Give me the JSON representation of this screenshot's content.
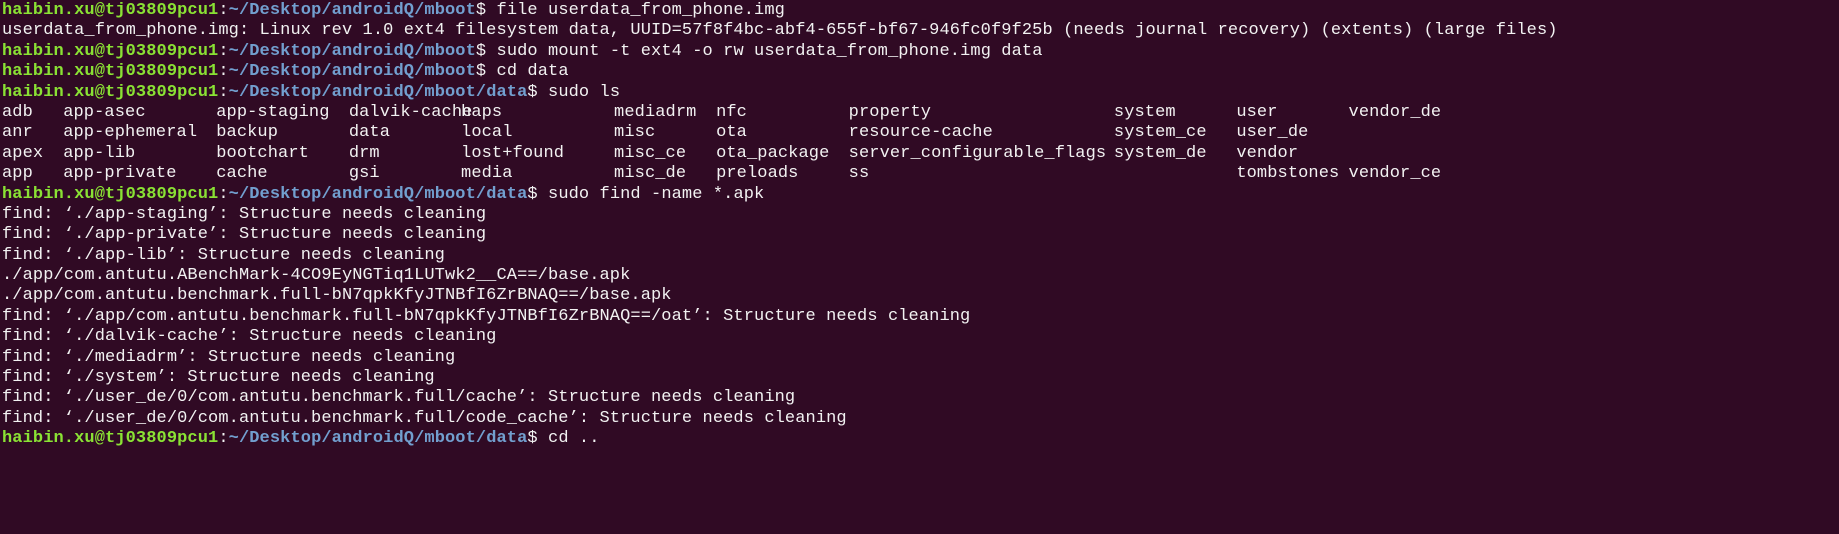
{
  "colors": {
    "background": "#300a24",
    "user_host": "#8ae234",
    "path": "#729fcf",
    "text": "#f2f2f2"
  },
  "prompt_user": "haibin.xu@tj03809pcu1",
  "lines": [
    {
      "type": "prompt",
      "path": "~/Desktop/androidQ/mboot",
      "cmd": "file userdata_from_phone.img"
    },
    {
      "type": "out",
      "text": "userdata_from_phone.img: Linux rev 1.0 ext4 filesystem data, UUID=57f8f4bc-abf4-655f-bf67-946fc0f9f25b (needs journal recovery) (extents) (large files)"
    },
    {
      "type": "prompt",
      "path": "~/Desktop/androidQ/mboot",
      "cmd": "sudo mount -t ext4 -o rw userdata_from_phone.img data"
    },
    {
      "type": "prompt",
      "path": "~/Desktop/androidQ/mboot",
      "cmd": "cd data"
    },
    {
      "type": "prompt",
      "path": "~/Desktop/androidQ/mboot/data",
      "cmd": "sudo ls"
    },
    {
      "type": "ls",
      "cells": [
        "adb",
        "app-asec",
        "app-staging",
        "dalvik-cache",
        "haps",
        "mediadrm",
        "nfc",
        "property",
        "system",
        "user",
        "vendor_de"
      ]
    },
    {
      "type": "ls",
      "cells": [
        "anr",
        "app-ephemeral",
        "backup",
        "data",
        "local",
        "misc",
        "ota",
        "resource-cache",
        "system_ce",
        "user_de",
        ""
      ]
    },
    {
      "type": "ls",
      "cells": [
        "apex",
        "app-lib",
        "bootchart",
        "drm",
        "lost+found",
        "misc_ce",
        "ota_package",
        "server_configurable_flags",
        "system_de",
        "vendor",
        ""
      ]
    },
    {
      "type": "ls",
      "cells": [
        "app",
        "app-private",
        "cache",
        "gsi",
        "media",
        "misc_de",
        "preloads",
        "ss",
        "",
        "tombstones",
        "vendor_ce"
      ]
    },
    {
      "type": "prompt",
      "path": "~/Desktop/androidQ/mboot/data",
      "cmd": "sudo find -name *.apk"
    },
    {
      "type": "out",
      "text": "find: ‘./app-staging’: Structure needs cleaning"
    },
    {
      "type": "out",
      "text": "find: ‘./app-private’: Structure needs cleaning"
    },
    {
      "type": "out",
      "text": "find: ‘./app-lib’: Structure needs cleaning"
    },
    {
      "type": "out",
      "text": "./app/com.antutu.ABenchMark-4CO9EyNGTiq1LUTwk2__CA==/base.apk"
    },
    {
      "type": "out",
      "text": "./app/com.antutu.benchmark.full-bN7qpkKfyJTNBfI6ZrBNAQ==/base.apk"
    },
    {
      "type": "out",
      "text": "find: ‘./app/com.antutu.benchmark.full-bN7qpkKfyJTNBfI6ZrBNAQ==/oat’: Structure needs cleaning"
    },
    {
      "type": "out",
      "text": "find: ‘./dalvik-cache’: Structure needs cleaning"
    },
    {
      "type": "out",
      "text": "find: ‘./mediadrm’: Structure needs cleaning"
    },
    {
      "type": "out",
      "text": "find: ‘./system’: Structure needs cleaning"
    },
    {
      "type": "out",
      "text": "find: ‘./user_de/0/com.antutu.benchmark.full/cache’: Structure needs cleaning"
    },
    {
      "type": "out",
      "text": "find: ‘./user_de/0/com.antutu.benchmark.full/code_cache’: Structure needs cleaning"
    },
    {
      "type": "prompt",
      "path": "~/Desktop/androidQ/mboot/data",
      "cmd": "cd .."
    }
  ]
}
